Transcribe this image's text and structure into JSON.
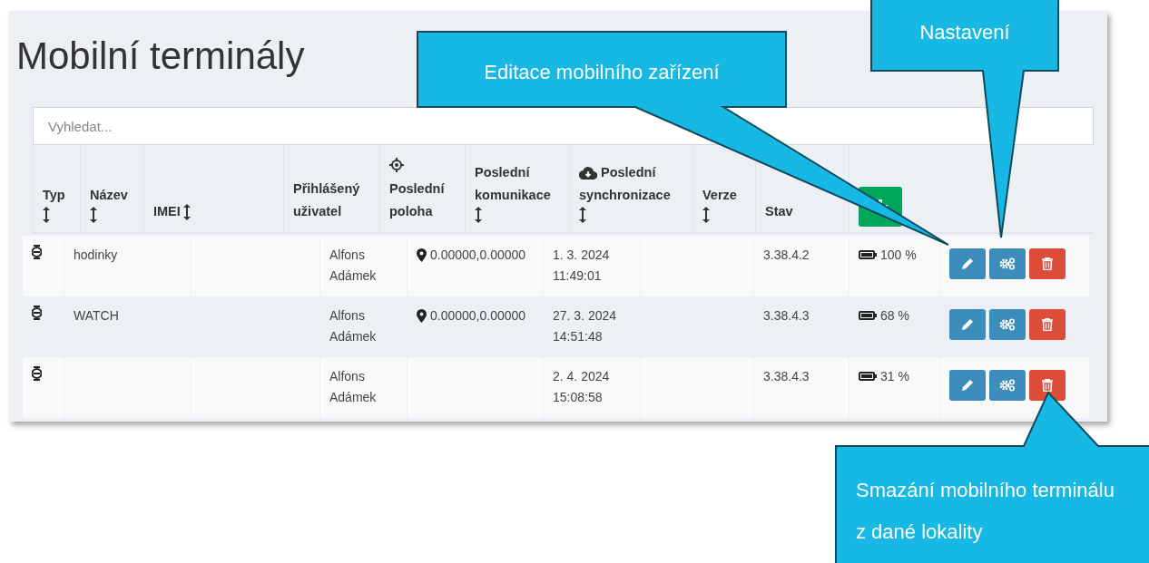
{
  "page": {
    "title": "Mobilní terminály"
  },
  "search": {
    "placeholder": "Vyhledat..."
  },
  "table": {
    "columns": [
      {
        "label": "Typ",
        "kind": "plain",
        "sortable": true
      },
      {
        "label": "Název",
        "kind": "plain",
        "sortable": true
      },
      {
        "label": "IMEI",
        "kind": "inline",
        "sortable": true
      },
      {
        "label": "Přihlášený uživatel",
        "kind": "plain",
        "sortable": false
      },
      {
        "label": "Poslední poloha",
        "kind": "location",
        "sortable": false
      },
      {
        "label": "Poslední komunikace",
        "kind": "plain",
        "sortable": true
      },
      {
        "label": "Poslední synchronizace",
        "kind": "sync",
        "sortable": true
      },
      {
        "label": "Verze",
        "kind": "plain",
        "sortable": true
      },
      {
        "label": "Stav",
        "kind": "plain",
        "sortable": false
      },
      {
        "kind": "add"
      }
    ],
    "rows": [
      {
        "name": "hodinky",
        "user": "Alfons Adámek",
        "location": "0.00000,0.00000",
        "communication": [
          "1. 3. 2024",
          "11:49:01"
        ],
        "version": "3.38.4.2",
        "battery": "100 %"
      },
      {
        "name": "WATCH",
        "user": "Alfons Adámek",
        "location": "0.00000,0.00000",
        "communication": [
          "27. 3. 2024",
          "14:51:48"
        ],
        "version": "3.38.4.3",
        "battery": "68 %"
      },
      {
        "user": "Alfons Adámek",
        "communication": [
          "2. 4. 2024",
          "15:08:58"
        ],
        "version": "3.38.4.3",
        "battery": "31 %"
      }
    ]
  },
  "callouts": [
    {
      "text": "Editace mobilního zařízení"
    },
    {
      "text": "Nastavení"
    },
    {
      "text": "Smazání mobilního terminálu z dané lokality"
    }
  ]
}
